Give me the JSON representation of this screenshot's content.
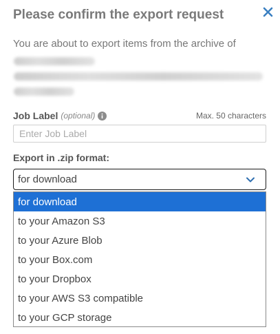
{
  "dialog": {
    "title": "Please confirm the export request",
    "intro": "You are about to export items from the archive of"
  },
  "job_label": {
    "label": "Job Label",
    "optional": "(optional)",
    "max_chars": "Max. 50 characters",
    "placeholder": "Enter Job Label",
    "value": ""
  },
  "export": {
    "label": "Export in .zip format:",
    "selected": "for download",
    "options": [
      "for download",
      "to your Amazon S3",
      "to your Azure Blob",
      "to your Box.com",
      "to your Dropbox",
      "to your AWS S3 compatible",
      "to your GCP storage"
    ],
    "selected_index": 0
  },
  "colors": {
    "accent": "#1e70d5",
    "title": "#7a7a7a",
    "close_icon": "#3a7fc1"
  },
  "icons": [
    "close-icon",
    "info-icon",
    "chevron-down-icon"
  ]
}
